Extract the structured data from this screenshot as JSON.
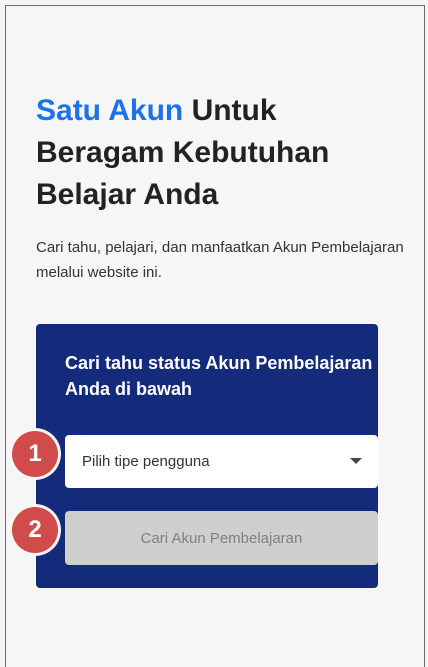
{
  "hero": {
    "title_accent": "Satu Akun",
    "title_line1_rest": " Untuk",
    "title_line2": "Beragam Kebutuhan",
    "title_line3": "Belajar Anda",
    "description": "Cari tahu, pelajari, dan manfaatkan Akun Pembelajaran melalui website ini."
  },
  "card": {
    "title": "Cari tahu status Akun Pembelajaran Anda di bawah",
    "user_type_select": {
      "placeholder": "Pilih tipe pengguna",
      "icon": "caret-down-icon"
    },
    "search_button_label": "Cari Akun Pembelajaran"
  },
  "steps": [
    "1",
    "2"
  ],
  "colors": {
    "accent": "#1a73e8",
    "card_background": "#132b7a",
    "badge": "#d24b4b",
    "disabled_button": "#cfcfcf"
  }
}
